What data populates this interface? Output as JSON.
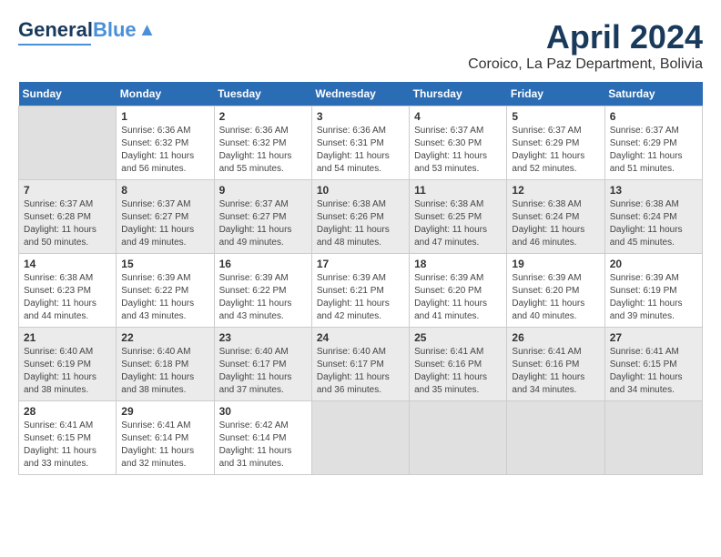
{
  "logo": {
    "general": "General",
    "blue": "Blue"
  },
  "header": {
    "title": "April 2024",
    "subtitle": "Coroico, La Paz Department, Bolivia"
  },
  "days_of_week": [
    "Sunday",
    "Monday",
    "Tuesday",
    "Wednesday",
    "Thursday",
    "Friday",
    "Saturday"
  ],
  "weeks": [
    [
      {
        "num": "",
        "info": ""
      },
      {
        "num": "1",
        "info": "Sunrise: 6:36 AM\nSunset: 6:32 PM\nDaylight: 11 hours\nand 56 minutes."
      },
      {
        "num": "2",
        "info": "Sunrise: 6:36 AM\nSunset: 6:32 PM\nDaylight: 11 hours\nand 55 minutes."
      },
      {
        "num": "3",
        "info": "Sunrise: 6:36 AM\nSunset: 6:31 PM\nDaylight: 11 hours\nand 54 minutes."
      },
      {
        "num": "4",
        "info": "Sunrise: 6:37 AM\nSunset: 6:30 PM\nDaylight: 11 hours\nand 53 minutes."
      },
      {
        "num": "5",
        "info": "Sunrise: 6:37 AM\nSunset: 6:29 PM\nDaylight: 11 hours\nand 52 minutes."
      },
      {
        "num": "6",
        "info": "Sunrise: 6:37 AM\nSunset: 6:29 PM\nDaylight: 11 hours\nand 51 minutes."
      }
    ],
    [
      {
        "num": "7",
        "info": "Sunrise: 6:37 AM\nSunset: 6:28 PM\nDaylight: 11 hours\nand 50 minutes."
      },
      {
        "num": "8",
        "info": "Sunrise: 6:37 AM\nSunset: 6:27 PM\nDaylight: 11 hours\nand 49 minutes."
      },
      {
        "num": "9",
        "info": "Sunrise: 6:37 AM\nSunset: 6:27 PM\nDaylight: 11 hours\nand 49 minutes."
      },
      {
        "num": "10",
        "info": "Sunrise: 6:38 AM\nSunset: 6:26 PM\nDaylight: 11 hours\nand 48 minutes."
      },
      {
        "num": "11",
        "info": "Sunrise: 6:38 AM\nSunset: 6:25 PM\nDaylight: 11 hours\nand 47 minutes."
      },
      {
        "num": "12",
        "info": "Sunrise: 6:38 AM\nSunset: 6:24 PM\nDaylight: 11 hours\nand 46 minutes."
      },
      {
        "num": "13",
        "info": "Sunrise: 6:38 AM\nSunset: 6:24 PM\nDaylight: 11 hours\nand 45 minutes."
      }
    ],
    [
      {
        "num": "14",
        "info": "Sunrise: 6:38 AM\nSunset: 6:23 PM\nDaylight: 11 hours\nand 44 minutes."
      },
      {
        "num": "15",
        "info": "Sunrise: 6:39 AM\nSunset: 6:22 PM\nDaylight: 11 hours\nand 43 minutes."
      },
      {
        "num": "16",
        "info": "Sunrise: 6:39 AM\nSunset: 6:22 PM\nDaylight: 11 hours\nand 43 minutes."
      },
      {
        "num": "17",
        "info": "Sunrise: 6:39 AM\nSunset: 6:21 PM\nDaylight: 11 hours\nand 42 minutes."
      },
      {
        "num": "18",
        "info": "Sunrise: 6:39 AM\nSunset: 6:20 PM\nDaylight: 11 hours\nand 41 minutes."
      },
      {
        "num": "19",
        "info": "Sunrise: 6:39 AM\nSunset: 6:20 PM\nDaylight: 11 hours\nand 40 minutes."
      },
      {
        "num": "20",
        "info": "Sunrise: 6:39 AM\nSunset: 6:19 PM\nDaylight: 11 hours\nand 39 minutes."
      }
    ],
    [
      {
        "num": "21",
        "info": "Sunrise: 6:40 AM\nSunset: 6:19 PM\nDaylight: 11 hours\nand 38 minutes."
      },
      {
        "num": "22",
        "info": "Sunrise: 6:40 AM\nSunset: 6:18 PM\nDaylight: 11 hours\nand 38 minutes."
      },
      {
        "num": "23",
        "info": "Sunrise: 6:40 AM\nSunset: 6:17 PM\nDaylight: 11 hours\nand 37 minutes."
      },
      {
        "num": "24",
        "info": "Sunrise: 6:40 AM\nSunset: 6:17 PM\nDaylight: 11 hours\nand 36 minutes."
      },
      {
        "num": "25",
        "info": "Sunrise: 6:41 AM\nSunset: 6:16 PM\nDaylight: 11 hours\nand 35 minutes."
      },
      {
        "num": "26",
        "info": "Sunrise: 6:41 AM\nSunset: 6:16 PM\nDaylight: 11 hours\nand 34 minutes."
      },
      {
        "num": "27",
        "info": "Sunrise: 6:41 AM\nSunset: 6:15 PM\nDaylight: 11 hours\nand 34 minutes."
      }
    ],
    [
      {
        "num": "28",
        "info": "Sunrise: 6:41 AM\nSunset: 6:15 PM\nDaylight: 11 hours\nand 33 minutes."
      },
      {
        "num": "29",
        "info": "Sunrise: 6:41 AM\nSunset: 6:14 PM\nDaylight: 11 hours\nand 32 minutes."
      },
      {
        "num": "30",
        "info": "Sunrise: 6:42 AM\nSunset: 6:14 PM\nDaylight: 11 hours\nand 31 minutes."
      },
      {
        "num": "",
        "info": ""
      },
      {
        "num": "",
        "info": ""
      },
      {
        "num": "",
        "info": ""
      },
      {
        "num": "",
        "info": ""
      }
    ]
  ]
}
